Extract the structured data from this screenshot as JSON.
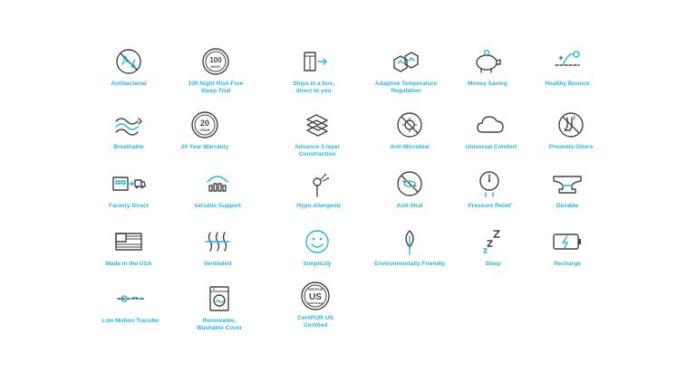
{
  "colors": {
    "accent": "#29b6e0",
    "icon_stroke": "#444444",
    "background": "#ffffff"
  },
  "icon_text": {
    "trial_top": "100 NIGHT",
    "trial_big": "100",
    "trial_mid": "NIGHT",
    "warranty_big": "20",
    "warranty_mid": "YEAR",
    "certipur_top": "CERTIPUR",
    "certipur_big": "US",
    "certipur_bottom": "CERTIFIED"
  },
  "features": [
    {
      "icon": "antibacterial-icon",
      "label": "Antibacterial"
    },
    {
      "icon": "trial-badge-icon",
      "label": "100 Night Risk-Free\nSleep Trial"
    },
    {
      "icon": "box-arrow-icon",
      "label": "Ships in a box,\ndirect to you"
    },
    {
      "icon": "temperature-cubes-icon",
      "label": "Adaptive Temperature\nRegulation"
    },
    {
      "icon": "piggy-bank-icon",
      "label": "Money Saving"
    },
    {
      "icon": "bounce-icon",
      "label": "Healthy Bounce"
    },
    {
      "icon": "airflow-icon",
      "label": "Breathable"
    },
    {
      "icon": "warranty-badge-icon",
      "label": "20 Year Warranty"
    },
    {
      "icon": "layers-icon",
      "label": "Advance 3-layer\nConstruction"
    },
    {
      "icon": "anti-microbial-icon",
      "label": "Anti-Microbial"
    },
    {
      "icon": "cloud-icon",
      "label": "Universal Comfort"
    },
    {
      "icon": "no-odor-icon",
      "label": "Prevents Odors"
    },
    {
      "icon": "factory-truck-icon",
      "label": "Factory Direct"
    },
    {
      "icon": "support-icon",
      "label": "Variable Support"
    },
    {
      "icon": "dandelion-icon",
      "label": "Hypo-Allergenic"
    },
    {
      "icon": "anti-viral-icon",
      "label": "Anti-Viral"
    },
    {
      "icon": "pressure-gauge-icon",
      "label": "Pressure Relief"
    },
    {
      "icon": "anvil-icon",
      "label": "Durable"
    },
    {
      "icon": "us-flag-icon",
      "label": "Made in the USA"
    },
    {
      "icon": "ventilation-icon",
      "label": "Ventilated"
    },
    {
      "icon": "smiley-icon",
      "label": "Simplicity"
    },
    {
      "icon": "leaf-icon",
      "label": "Environmentally Friendly"
    },
    {
      "icon": "sleep-zzz-icon",
      "label": "Sleep"
    },
    {
      "icon": "battery-icon",
      "label": "Recharge"
    },
    {
      "icon": "motion-transfer-icon",
      "label": "Low Motion Transfer"
    },
    {
      "icon": "washing-machine-icon",
      "label": "Removable,\nWashable Cover"
    },
    {
      "icon": "certipur-badge-icon",
      "label": "CertiPUR-US\nCertified"
    }
  ]
}
